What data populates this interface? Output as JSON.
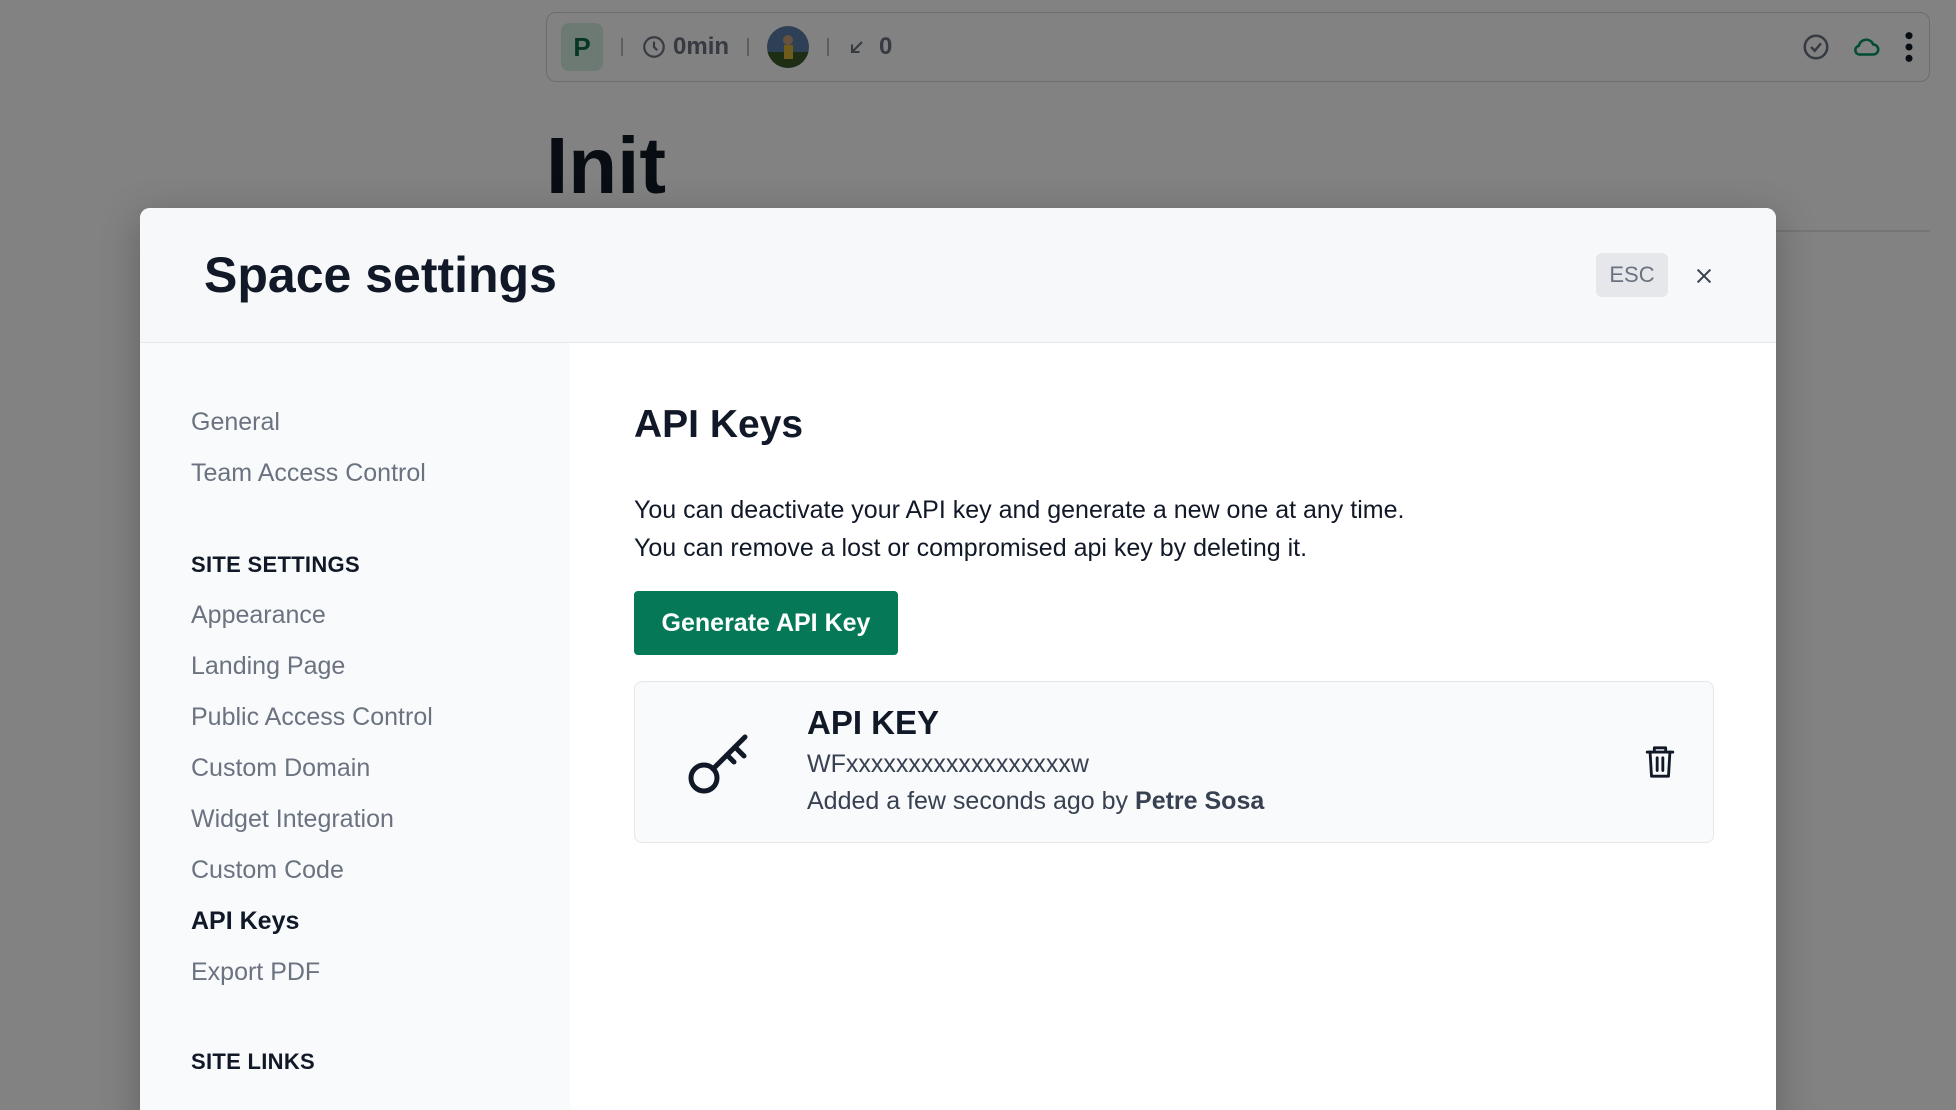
{
  "background": {
    "space_initial": "P",
    "timer": "0min",
    "links_count": "0",
    "page_title": "Init"
  },
  "modal": {
    "title": "Space settings",
    "esc_label": "ESC"
  },
  "sidebar": {
    "top_items": [
      {
        "label": "General"
      },
      {
        "label": "Team Access Control"
      }
    ],
    "site_settings_heading": "SITE SETTINGS",
    "site_settings_items": [
      {
        "label": "Appearance"
      },
      {
        "label": "Landing Page"
      },
      {
        "label": "Public Access Control"
      },
      {
        "label": "Custom Domain"
      },
      {
        "label": "Widget Integration"
      },
      {
        "label": "Custom Code"
      },
      {
        "label": "API Keys",
        "active": true
      },
      {
        "label": "Export PDF"
      }
    ],
    "site_links_heading": "SITE LINKS"
  },
  "content": {
    "title": "API Keys",
    "description_line1": "You can deactivate your API key and generate a new one at any time.",
    "description_line2": "You can remove a lost or compromised api key by deleting it.",
    "generate_button": "Generate API Key",
    "key_card": {
      "title": "API KEY",
      "value": "WFxxxxxxxxxxxxxxxxxxw",
      "added_prefix": "Added a few seconds ago by",
      "added_by": "Petre Sosa"
    }
  },
  "colors": {
    "accent": "#047857",
    "overlay": "rgba(0,0,0,0.49)",
    "space_badge_bg": "#d6efe2",
    "cloud_icon": "#059669"
  }
}
